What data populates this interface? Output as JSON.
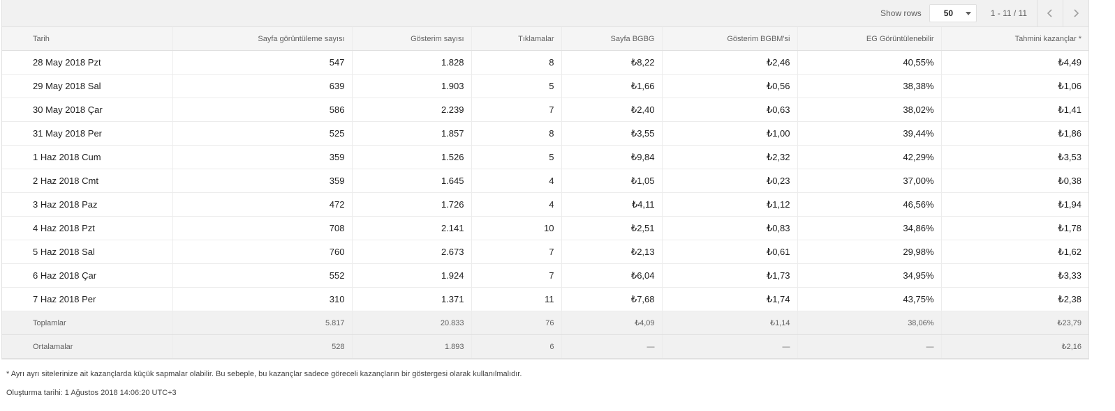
{
  "toolbar": {
    "show_rows_label": "Show rows",
    "rows_value": "50",
    "range": "1 - 11 / 11",
    "prev_icon": "chevron-left-icon",
    "next_icon": "chevron-right-icon"
  },
  "table": {
    "columns": [
      "Tarih",
      "Sayfa görüntüleme sayısı",
      "Gösterim sayısı",
      "Tıklamalar",
      "Sayfa BGBG",
      "Gösterim BGBM'si",
      "EG Görüntülenebilir",
      "Tahmini kazançlar *"
    ],
    "rows": [
      [
        "28 May 2018 Pzt",
        "547",
        "1.828",
        "8",
        "₺8,22",
        "₺2,46",
        "40,55%",
        "₺4,49"
      ],
      [
        "29 May 2018 Sal",
        "639",
        "1.903",
        "5",
        "₺1,66",
        "₺0,56",
        "38,38%",
        "₺1,06"
      ],
      [
        "30 May 2018 Çar",
        "586",
        "2.239",
        "7",
        "₺2,40",
        "₺0,63",
        "38,02%",
        "₺1,41"
      ],
      [
        "31 May 2018 Per",
        "525",
        "1.857",
        "8",
        "₺3,55",
        "₺1,00",
        "39,44%",
        "₺1,86"
      ],
      [
        "1 Haz 2018 Cum",
        "359",
        "1.526",
        "5",
        "₺9,84",
        "₺2,32",
        "42,29%",
        "₺3,53"
      ],
      [
        "2 Haz 2018 Cmt",
        "359",
        "1.645",
        "4",
        "₺1,05",
        "₺0,23",
        "37,00%",
        "₺0,38"
      ],
      [
        "3 Haz 2018 Paz",
        "472",
        "1.726",
        "4",
        "₺4,11",
        "₺1,12",
        "46,56%",
        "₺1,94"
      ],
      [
        "4 Haz 2018 Pzt",
        "708",
        "2.141",
        "10",
        "₺2,51",
        "₺0,83",
        "34,86%",
        "₺1,78"
      ],
      [
        "5 Haz 2018 Sal",
        "760",
        "2.673",
        "7",
        "₺2,13",
        "₺0,61",
        "29,98%",
        "₺1,62"
      ],
      [
        "6 Haz 2018 Çar",
        "552",
        "1.924",
        "7",
        "₺6,04",
        "₺1,73",
        "34,95%",
        "₺3,33"
      ],
      [
        "7 Haz 2018 Per",
        "310",
        "1.371",
        "11",
        "₺7,68",
        "₺1,74",
        "43,75%",
        "₺2,38"
      ]
    ],
    "totals": [
      "Toplamlar",
      "5.817",
      "20.833",
      "76",
      "₺4,09",
      "₺1,14",
      "38,06%",
      "₺23,79"
    ],
    "averages": [
      "Ortalamalar",
      "528",
      "1.893",
      "6",
      "—",
      "—",
      "—",
      "₺2,16"
    ]
  },
  "footer": {
    "note": "* Ayrı ayrı sitelerinize ait kazançlarda küçük sapmalar olabilir. Bu sebeple, bu kazançlar sadece göreceli kazançların bir göstergesi olarak kullanılmalıdır.",
    "generated": "Oluşturma tarihi: 1 Ağustos 2018 14:06:20 UTC+3"
  }
}
